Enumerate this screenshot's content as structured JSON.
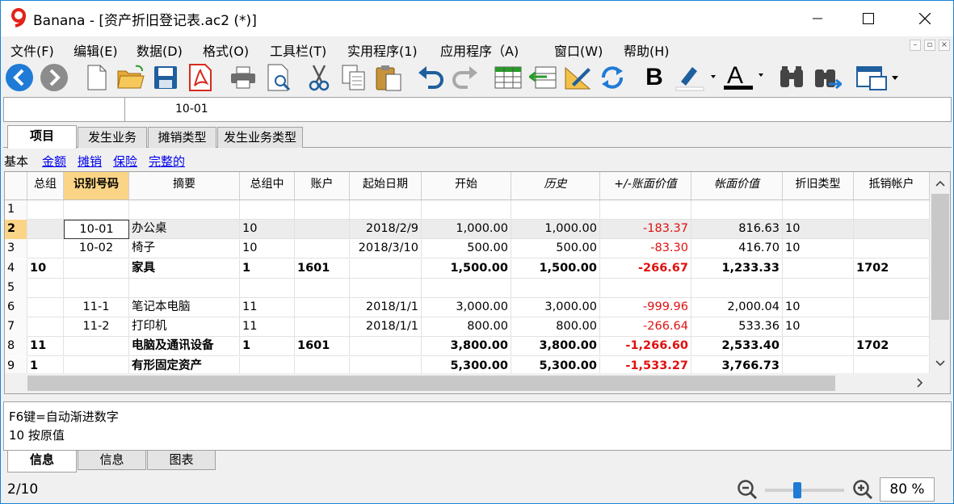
{
  "window": {
    "app_name": "Banana",
    "title": "Banana - [资产折旧登记表.ac2 (*)]"
  },
  "menu": [
    "文件(F)",
    "编辑(E)",
    "数据(D)",
    "格式(O)",
    "工具栏(T)",
    "实用程序(1)",
    "应用程序（A)",
    "窗口(W)",
    "帮助(H)"
  ],
  "toolbar": {
    "icons": [
      "back-icon",
      "forward-icon",
      "new-file-icon",
      "open-folder-icon",
      "save-icon",
      "pdf-icon",
      "print-icon",
      "print-preview-icon",
      "cut-icon",
      "copy-icon",
      "paste-icon",
      "undo-icon",
      "redo-icon",
      "add-rows-icon",
      "move-rows-icon",
      "edit-tool-icon",
      "recalculate-icon",
      "bold-icon",
      "highlight-color-icon",
      "font-color-icon",
      "find-icon",
      "find-replace-icon",
      "window-icon"
    ],
    "bold_glyph": "B",
    "font_color_glyph": "A"
  },
  "formula_bar": {
    "cell_ref": "",
    "content": "10-01"
  },
  "table_tabs": [
    "项目",
    "发生业务",
    "摊销类型",
    "发生业务类型"
  ],
  "views": [
    "基本",
    "金额",
    "摊销",
    "保险",
    "完整的"
  ],
  "columns": [
    "总组",
    "识别号码",
    "摘要",
    "总组中",
    "账户",
    "起始日期",
    "开始",
    "历史",
    "+/-账面价值",
    "帐面价值",
    "折旧类型",
    "抵销帐户"
  ],
  "rows": [
    {
      "num": "1",
      "group": "",
      "id": "",
      "desc": "",
      "gin": "",
      "acct": "",
      "date": "",
      "start": "",
      "hist": "",
      "diff": "",
      "book": "",
      "type": "",
      "offset": "",
      "bold": false
    },
    {
      "num": "2",
      "group": "",
      "id": "10-01",
      "desc": "办公桌",
      "gin": "10",
      "acct": "",
      "date": "2018/2/9",
      "start": "1,000.00",
      "hist": "1,000.00",
      "diff": "-183.37",
      "book": "816.63",
      "type": "10",
      "offset": "",
      "bold": false
    },
    {
      "num": "3",
      "group": "",
      "id": "10-02",
      "desc": "椅子",
      "gin": "10",
      "acct": "",
      "date": "2018/3/10",
      "start": "500.00",
      "hist": "500.00",
      "diff": "-83.30",
      "book": "416.70",
      "type": "10",
      "offset": "",
      "bold": false
    },
    {
      "num": "4",
      "group": "10",
      "id": "",
      "desc": "家具",
      "gin": "1",
      "acct": "1601",
      "date": "",
      "start": "1,500.00",
      "hist": "1,500.00",
      "diff": "-266.67",
      "book": "1,233.33",
      "type": "",
      "offset": "1702",
      "bold": true
    },
    {
      "num": "5",
      "group": "",
      "id": "",
      "desc": "",
      "gin": "",
      "acct": "",
      "date": "",
      "start": "",
      "hist": "",
      "diff": "",
      "book": "",
      "type": "",
      "offset": "",
      "bold": false
    },
    {
      "num": "6",
      "group": "",
      "id": "11-1",
      "desc": "笔记本电脑",
      "gin": "11",
      "acct": "",
      "date": "2018/1/1",
      "start": "3,000.00",
      "hist": "3,000.00",
      "diff": "-999.96",
      "book": "2,000.04",
      "type": "10",
      "offset": "",
      "bold": false
    },
    {
      "num": "7",
      "group": "",
      "id": "11-2",
      "desc": "打印机",
      "gin": "11",
      "acct": "",
      "date": "2018/1/1",
      "start": "800.00",
      "hist": "800.00",
      "diff": "-266.64",
      "book": "533.36",
      "type": "10",
      "offset": "",
      "bold": false
    },
    {
      "num": "8",
      "group": "11",
      "id": "",
      "desc": "电脑及通讯设备",
      "gin": "1",
      "acct": "1601",
      "date": "",
      "start": "3,800.00",
      "hist": "3,800.00",
      "diff": "-1,266.60",
      "book": "2,533.40",
      "type": "",
      "offset": "1702",
      "bold": true
    },
    {
      "num": "9",
      "group": "1",
      "id": "",
      "desc": "有形固定资产",
      "gin": "",
      "acct": "",
      "date": "",
      "start": "5,300.00",
      "hist": "5,300.00",
      "diff": "-1,533.27",
      "book": "3,766.73",
      "type": "",
      "offset": "",
      "bold": true
    }
  ],
  "info": {
    "line1": "F6键=自动渐进数字",
    "line2": "10 按原值"
  },
  "bottom_tabs": [
    "信息",
    "信息",
    "图表"
  ],
  "status": {
    "row_position": "2/10",
    "zoom": "80 %",
    "zoom_level": 0.4
  },
  "colors": {
    "accent": "#1f7bd6",
    "selected_header": "#fbd587",
    "negative": "#e01010",
    "link": "#0000ee"
  }
}
